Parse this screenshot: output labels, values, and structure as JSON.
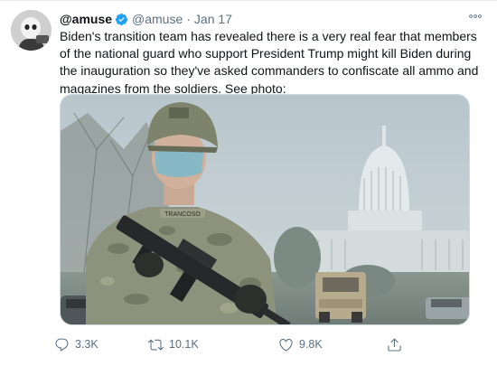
{
  "tweet": {
    "display_name": "@amuse",
    "handle": "@amuse",
    "separator": "·",
    "date": "Jan 17",
    "text": "Biden's transition team has revealed there is a very real fear that members of the national guard who support President Trump might kill Biden during the inauguration so they've asked commanders to confiscate all ammo and magazines from the soldiers. See photo:",
    "media_name_tape": "TRANCOSO"
  },
  "actions": {
    "replies": "3.3K",
    "retweets": "10.1K",
    "likes": "9.8K"
  },
  "colors": {
    "text": "#0f1419",
    "secondary": "#5b7083",
    "verified": "#1da1f2",
    "border": "#cfd9de"
  },
  "icons": {
    "verified": "verified-badge-icon",
    "more": "more-options-icon",
    "reply": "reply-icon",
    "retweet": "retweet-icon",
    "like": "heart-icon",
    "share": "share-icon"
  }
}
